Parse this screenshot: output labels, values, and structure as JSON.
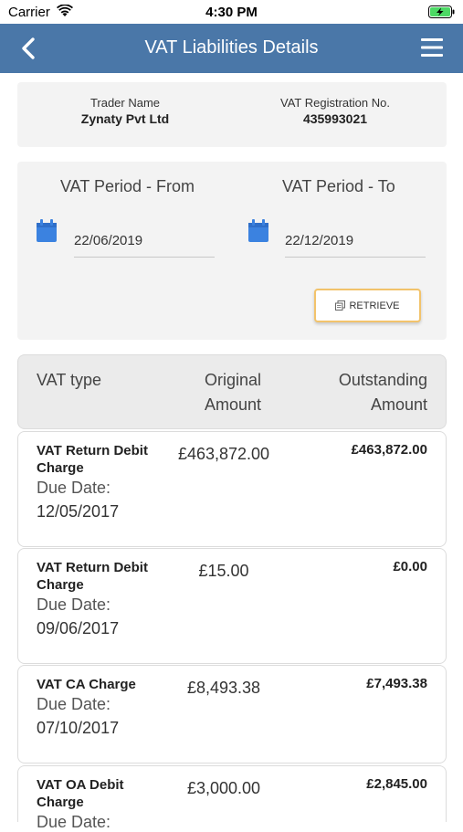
{
  "status_bar": {
    "carrier": "Carrier",
    "time": "4:30 PM"
  },
  "nav": {
    "title": "VAT Liabilities Details"
  },
  "trader": {
    "name_label": "Trader Name",
    "name_value": "Zynaty Pvt Ltd",
    "reg_label": "VAT Registration No.",
    "reg_value": "435993021"
  },
  "period": {
    "from_label": "VAT Period - From",
    "from_value": "22/06/2019",
    "to_label": "VAT Period - To",
    "to_value": "22/12/2019",
    "retrieve_label": "RETRIEVE"
  },
  "table": {
    "headers": {
      "type": "VAT type",
      "original_line1": "Original",
      "original_line2": "Amount",
      "outstanding_line1": "Outstanding",
      "outstanding_line2": "Amount"
    },
    "rows": [
      {
        "type": "VAT Return Debit Charge",
        "due_label": "Due Date:",
        "due_date": "12/05/2017",
        "original": "£463,872.00",
        "outstanding": "£463,872.00"
      },
      {
        "type": "VAT Return Debit Charge",
        "due_label": "Due Date:",
        "due_date": "09/06/2017",
        "original": "£15.00",
        "outstanding": "£0.00"
      },
      {
        "type": "VAT CA Charge",
        "due_label": "Due Date:",
        "due_date": "07/10/2017",
        "original": "£8,493.38",
        "outstanding": "£7,493.38"
      },
      {
        "type": "VAT OA Debit Charge",
        "due_label": "Due Date:",
        "due_date": "",
        "original": "£3,000.00",
        "outstanding": "£2,845.00"
      }
    ]
  },
  "colors": {
    "nav_bg": "#4a77a8",
    "calendar_icon": "#3b82e0",
    "retrieve_border": "#f2c36b",
    "battery_fill": "#4cd964"
  }
}
